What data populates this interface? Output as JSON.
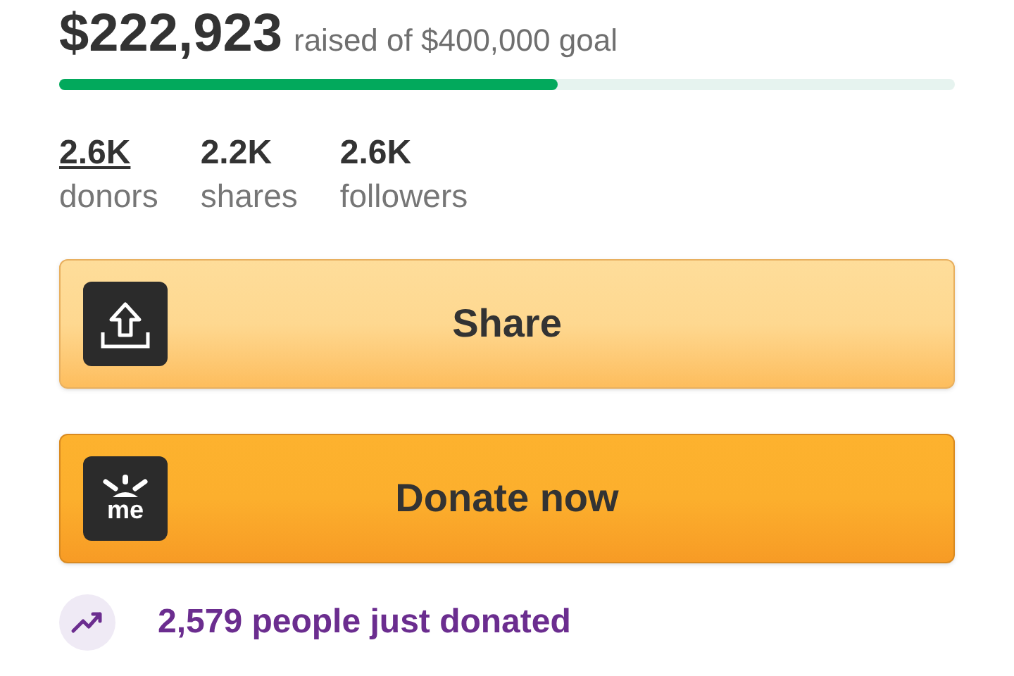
{
  "raised": {
    "amount": "$222,923",
    "goal_text": "raised of $400,000 goal",
    "level": 0.557
  },
  "stats": [
    {
      "value": "2.6K",
      "label": "donors",
      "underlined": true
    },
    {
      "value": "2.2K",
      "label": "shares",
      "underlined": false
    },
    {
      "value": "2.6K",
      "label": "followers",
      "underlined": false
    }
  ],
  "buttons": [
    {
      "kind": "share",
      "label": "Share"
    },
    {
      "kind": "donate",
      "label": "Donate now",
      "logo_text": "me"
    }
  ],
  "activity": {
    "text": "2,579 people just donated"
  }
}
